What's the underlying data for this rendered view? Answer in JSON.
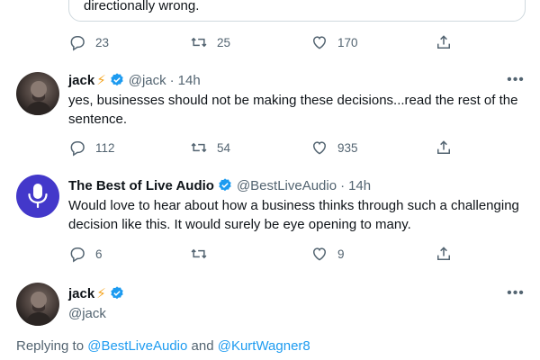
{
  "quoted_tweet": {
    "text_fragment": "directionally wrong."
  },
  "first_actions": {
    "reply": "23",
    "retweet": "25",
    "like": "170"
  },
  "tweets": [
    {
      "name": "jack",
      "badge": "⚡",
      "handle": "@jack",
      "time": "14h",
      "text": "yes, businesses should not be making these decisions...read the rest of the sentence.",
      "reply_count": "112",
      "retweet_count": "54",
      "like_count": "935",
      "avatar_icon": "person-photo-icon"
    },
    {
      "name": "The Best of Live Audio",
      "handle": "@BestLiveAudio",
      "time": "14h",
      "text": "Would love to hear about how a business thinks through such a challenging decision like this. It would surely be eye opening to many.",
      "reply_count": "6",
      "retweet_count": "",
      "like_count": "9",
      "avatar_icon": "microphone-icon"
    }
  ],
  "focused_tweet": {
    "name": "jack",
    "badge": "⚡",
    "handle": "@jack",
    "replying_prefix": "Replying to ",
    "replying_user1": "@BestLiveAudio",
    "replying_and": " and ",
    "replying_user2": "@KurtWagner8"
  },
  "separator": "·",
  "more_label": "•••",
  "colors": {
    "verified": "#1d9bf0",
    "link": "#1d9bf0",
    "muted": "#536471",
    "bolt": "#f5a623",
    "live_audio_avatar": "#4338ca"
  }
}
